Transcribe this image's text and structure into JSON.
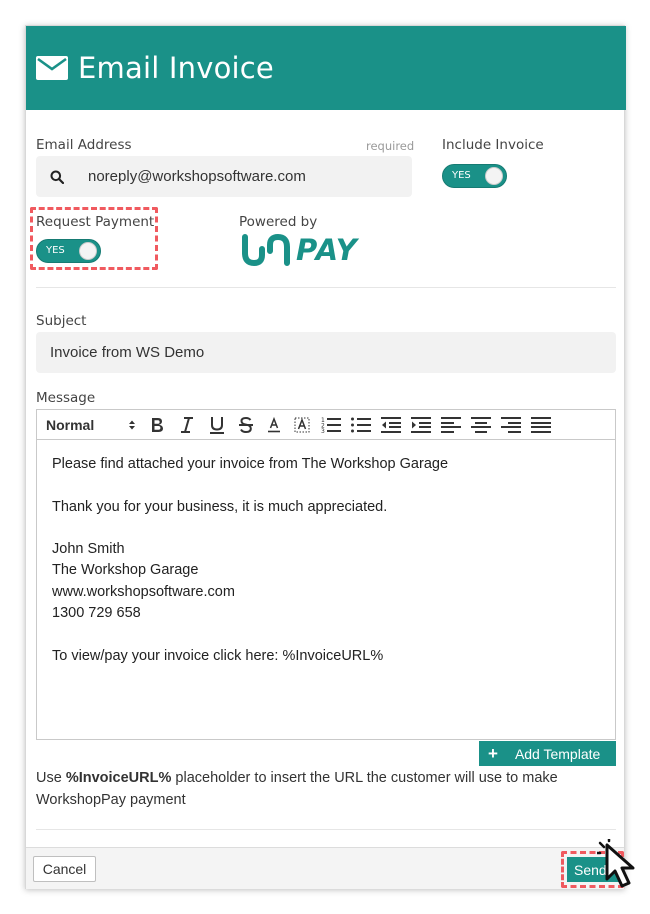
{
  "header": {
    "title": "Email Invoice",
    "icon": "envelope-icon"
  },
  "email": {
    "label": "Email Address",
    "required": "required",
    "value": "noreply@workshopsoftware.com",
    "icon": "search-icon"
  },
  "include_invoice": {
    "label": "Include Invoice",
    "toggle": "YES",
    "on": true
  },
  "request_payment": {
    "label": "Request Payment",
    "toggle": "YES",
    "on": true
  },
  "powered": {
    "label": "Powered by",
    "brand": "PAY"
  },
  "subject": {
    "label": "Subject",
    "value": "Invoice from WS Demo"
  },
  "message": {
    "label": "Message",
    "format": "Normal",
    "lines": [
      "Please find attached your invoice from The Workshop Garage",
      "",
      "Thank you for your business, it is much appreciated.",
      "",
      "John Smith",
      "The Workshop Garage",
      "www.workshopsoftware.com",
      "1300 729 658",
      "",
      "To view/pay your invoice click here: %InvoiceURL%"
    ]
  },
  "add_template": {
    "label": "Add Template"
  },
  "info": {
    "prefix": "Use ",
    "placeholder": "%InvoiceURL%",
    "suffix": " placeholder to insert the URL the customer will use to make WorkshopPay payment"
  },
  "footer": {
    "cancel": "Cancel",
    "send": "Send"
  },
  "colors": {
    "accent": "#1a9188",
    "highlight": "#f05a5f"
  }
}
